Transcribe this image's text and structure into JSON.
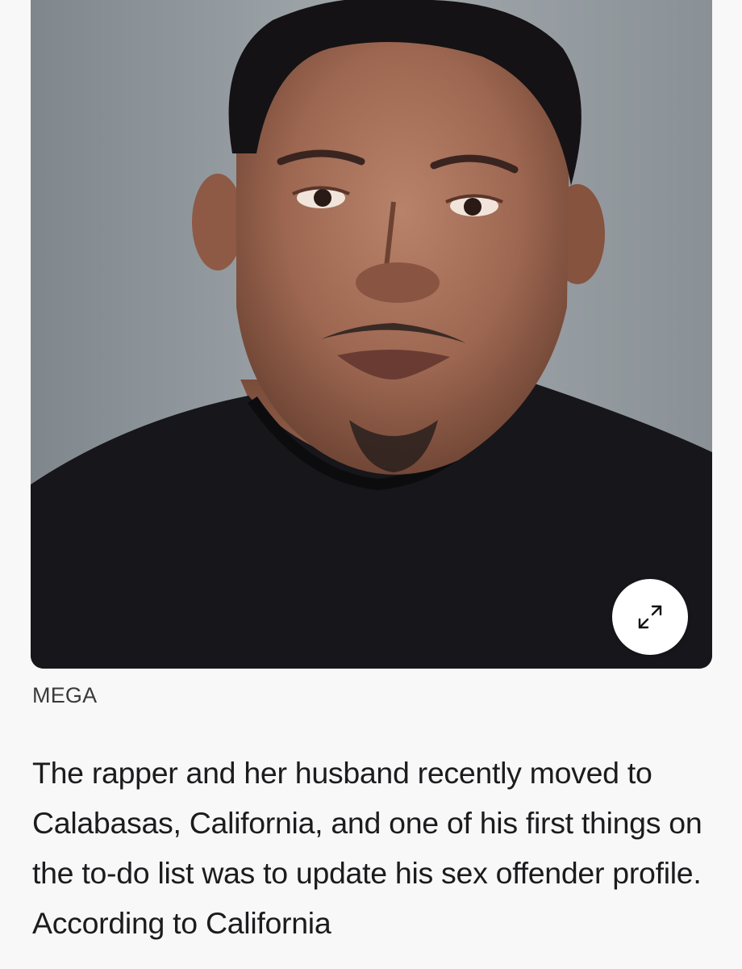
{
  "image": {
    "alt": "Mugshot photo",
    "credit": "MEGA",
    "expand_icon": "expand-arrows-icon"
  },
  "article": {
    "paragraph": "The rapper and her husband recently moved to Calabasas, California, and one of his first things on the to-do list was to update his sex offender profile. According to California"
  },
  "colors": {
    "page_background": "#f8f8f8",
    "text": "#1c1c1e",
    "credit_text": "#3a3a3a",
    "expand_button_bg": "#ffffff"
  }
}
